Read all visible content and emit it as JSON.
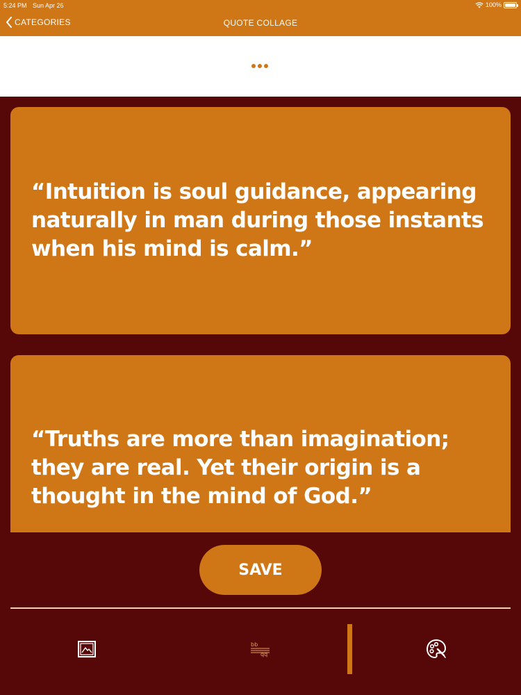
{
  "status_bar": {
    "time": "5:24 PM",
    "date": "Sun Apr 26",
    "battery": "100%",
    "icons": [
      "wifi-icon",
      "battery-icon"
    ]
  },
  "nav": {
    "back_label": "CATEGORIES",
    "title": "QUOTE COLLAGE",
    "icons": [
      "chevron-left-icon"
    ]
  },
  "quotes": [
    {
      "text": "“Intuition is soul guidance, appearing naturally in man during those instants when his mind is calm.”"
    },
    {
      "text": "“Truths are more than imagination; they are real. Yet their origin is a thought in the mind of God.”"
    }
  ],
  "actions": {
    "save_label": "SAVE"
  },
  "tab_bar": {
    "tabs": [
      {
        "icon": "image-icon"
      },
      {
        "icon": "font-style-icon",
        "selected": true
      },
      {
        "icon": "palette-icon"
      }
    ]
  },
  "colors": {
    "accent": "#cf7617",
    "background": "#560808",
    "divider": "#f1d2b0",
    "ad_background": "#ffffff"
  }
}
